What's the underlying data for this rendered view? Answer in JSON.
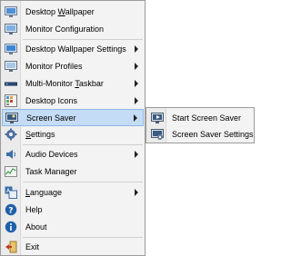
{
  "menu": {
    "items": [
      {
        "label": "Desktop Wallpaper",
        "icon": "wallpaper-icon"
      },
      {
        "label": "Monitor Configuration",
        "icon": "monitor-config-icon"
      },
      {
        "label": "Desktop Wallpaper Settings",
        "icon": "wallpaper-settings-icon"
      },
      {
        "label": "Monitor Profiles",
        "icon": "monitor-profiles-icon"
      },
      {
        "label": "Multi-Monitor Taskbar",
        "icon": "taskbar-icon"
      },
      {
        "label": "Desktop Icons",
        "icon": "desktop-icons-icon"
      },
      {
        "label": "Screen Saver",
        "icon": "screen-saver-icon"
      },
      {
        "label": "Settings",
        "icon": "gear-icon"
      },
      {
        "label": "Audio Devices",
        "icon": "speaker-icon"
      },
      {
        "label": "Task Manager",
        "icon": "task-manager-icon"
      },
      {
        "label": "Language",
        "icon": "language-icon"
      },
      {
        "label": "Help",
        "icon": "help-icon"
      },
      {
        "label": "About",
        "icon": "info-icon"
      },
      {
        "label": "Exit",
        "icon": "exit-icon"
      }
    ]
  },
  "submenu": {
    "items": [
      {
        "label": "Start Screen Saver",
        "icon": "start-screen-saver-icon"
      },
      {
        "label": "Screen Saver Settings",
        "icon": "screen-saver-settings-icon"
      }
    ]
  },
  "colors": {
    "highlight": "#c4dcf5",
    "highlight_border": "#8fb8e6",
    "menu_bg": "#f3f3f3"
  }
}
